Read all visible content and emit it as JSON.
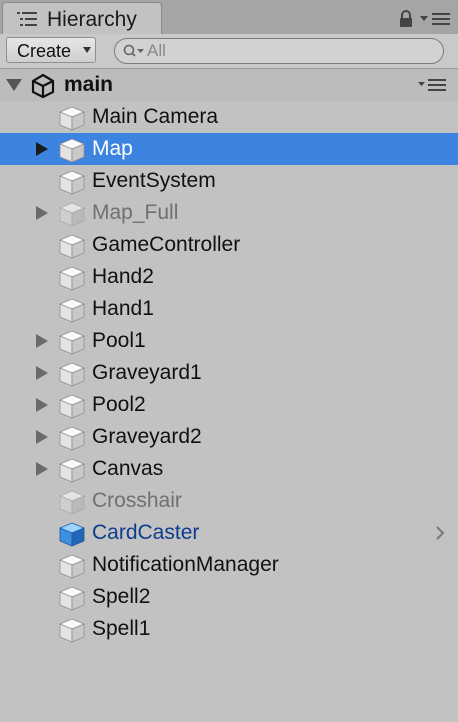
{
  "window": {
    "tab_title": "Hierarchy",
    "tab_icon": "hierarchy-list-icon",
    "lock_icon": "lock-icon",
    "menu_icon": "tab-menu-icon"
  },
  "toolbar": {
    "create_label": "Create",
    "search_placeholder": "All"
  },
  "scene": {
    "name": "main",
    "icon": "unity-logo-icon",
    "expanded": true
  },
  "colors": {
    "selection": "#3d84e0",
    "prefab_text": "#0e3c8f",
    "inactive_text": "#707070",
    "panel_bg": "#c2c2c2"
  },
  "items": [
    {
      "label": "Main Camera",
      "has_children": false,
      "selected": false,
      "active": true,
      "prefab": false
    },
    {
      "label": "Map",
      "has_children": true,
      "selected": true,
      "active": true,
      "prefab": false
    },
    {
      "label": "EventSystem",
      "has_children": false,
      "selected": false,
      "active": true,
      "prefab": false
    },
    {
      "label": "Map_Full",
      "has_children": true,
      "selected": false,
      "active": false,
      "prefab": false
    },
    {
      "label": "GameController",
      "has_children": false,
      "selected": false,
      "active": true,
      "prefab": false
    },
    {
      "label": "Hand2",
      "has_children": false,
      "selected": false,
      "active": true,
      "prefab": false
    },
    {
      "label": "Hand1",
      "has_children": false,
      "selected": false,
      "active": true,
      "prefab": false
    },
    {
      "label": "Pool1",
      "has_children": true,
      "selected": false,
      "active": true,
      "prefab": false
    },
    {
      "label": "Graveyard1",
      "has_children": true,
      "selected": false,
      "active": true,
      "prefab": false
    },
    {
      "label": "Pool2",
      "has_children": true,
      "selected": false,
      "active": true,
      "prefab": false
    },
    {
      "label": "Graveyard2",
      "has_children": true,
      "selected": false,
      "active": true,
      "prefab": false
    },
    {
      "label": "Canvas",
      "has_children": true,
      "selected": false,
      "active": true,
      "prefab": false
    },
    {
      "label": "Crosshair",
      "has_children": false,
      "selected": false,
      "active": false,
      "prefab": false
    },
    {
      "label": "CardCaster",
      "has_children": false,
      "selected": false,
      "active": true,
      "prefab": true
    },
    {
      "label": "NotificationManager",
      "has_children": false,
      "selected": false,
      "active": true,
      "prefab": false
    },
    {
      "label": "Spell2",
      "has_children": false,
      "selected": false,
      "active": true,
      "prefab": false
    },
    {
      "label": "Spell1",
      "has_children": false,
      "selected": false,
      "active": true,
      "prefab": false
    }
  ]
}
